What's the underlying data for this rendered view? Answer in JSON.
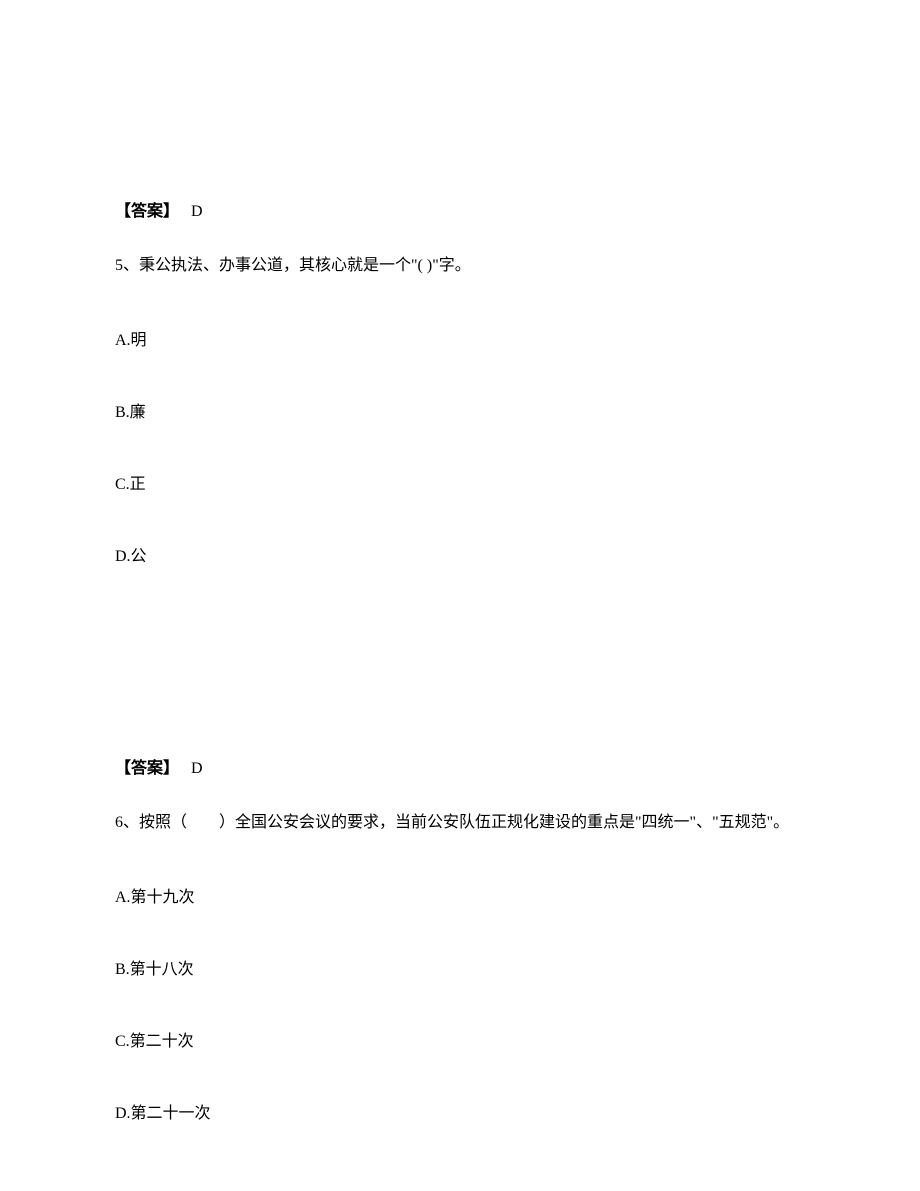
{
  "block1": {
    "answer_label": "【答案】",
    "answer_value": "D",
    "question_text": "5、秉公执法、办事公道，其核心就是一个\"(    )\"字。",
    "options": {
      "a": "A.明",
      "b": "B.廉",
      "c": "C.正",
      "d": "D.公"
    }
  },
  "block2": {
    "answer_label": "【答案】",
    "answer_value": "D",
    "question_text": "6、按照（　　）全国公安会议的要求，当前公安队伍正规化建设的重点是\"四统一\"、\"五规范\"。",
    "options": {
      "a": "A.第十九次",
      "b": "B.第十八次",
      "c": "C.第二十次",
      "d": "D.第二十一次"
    }
  }
}
